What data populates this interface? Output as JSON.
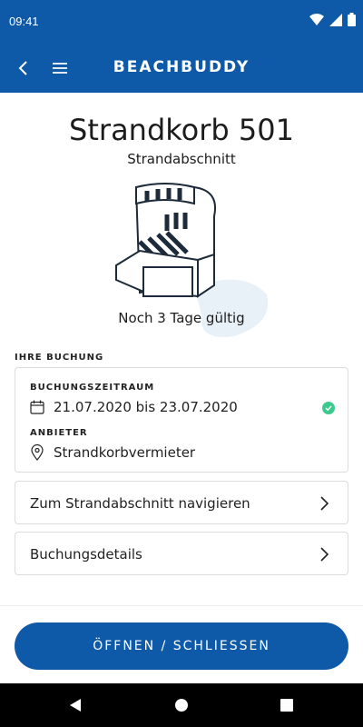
{
  "status_bar": {
    "time": "09:41"
  },
  "app_bar": {
    "title": "BEACHBUDDY"
  },
  "header": {
    "title": "Strandkorb 501",
    "subtitle": "Strandabschnitt",
    "validity": "Noch 3 Tage gültig"
  },
  "booking": {
    "section_label": "IHRE BUCHUNG",
    "period_label": "BUCHUNGSZEITRAUM",
    "period_value": "21.07.2020 bis 23.07.2020",
    "provider_label": "ANBIETER",
    "provider_value": "Strandkorbvermieter"
  },
  "actions": {
    "navigate_label": "Zum Strandabschnitt navigieren",
    "details_label": "Buchungsdetails",
    "main_button": "ÖFFNEN / SCHLIESSEN"
  },
  "colors": {
    "primary": "#0f5aa8",
    "success": "#3cc98d"
  },
  "icons": [
    "back-arrow-icon",
    "hamburger-menu-icon",
    "calendar-icon",
    "location-pin-icon",
    "check-circle-icon",
    "chevron-right-icon",
    "wifi-icon",
    "signal-icon",
    "battery-icon"
  ]
}
